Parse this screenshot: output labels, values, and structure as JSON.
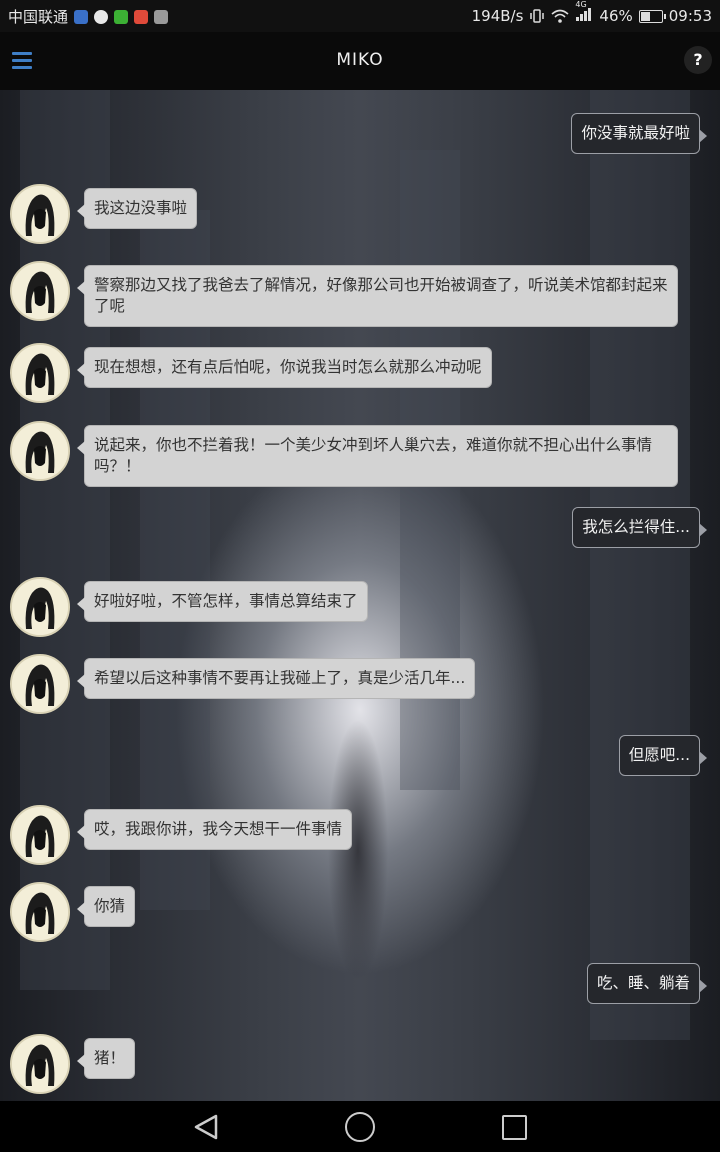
{
  "status_bar": {
    "carrier": "中国联通",
    "speed": "194B/s",
    "network_badge": "4G",
    "battery": "46%",
    "battery_level": 0.46,
    "time": "09:53",
    "icons": [
      "shield-icon",
      "qq-icon",
      "wechat-icon",
      "weibo-icon",
      "photo-icon",
      "vibrate-icon",
      "wifi-icon",
      "signal-icon",
      "battery-icon"
    ]
  },
  "app_bar": {
    "title": "MIKO",
    "help_label": "?",
    "menu_icon": "hamburger-menu-icon"
  },
  "colors": {
    "menu_blue": "#3f7fc7",
    "incoming_bubble": "#d3d3d3",
    "outgoing_bubble": "#25272c"
  },
  "messages": [
    {
      "from": "me",
      "text": "你没事就最好啦"
    },
    {
      "from": "miko",
      "text": "我这边没事啦"
    },
    {
      "from": "miko",
      "text": "警察那边又找了我爸去了解情况，好像那公司也开始被调查了，听说美术馆都封起来了呢"
    },
    {
      "from": "miko",
      "text": "现在想想，还有点后怕呢，你说我当时怎么就那么冲动呢"
    },
    {
      "from": "miko",
      "text": "说起来，你也不拦着我！一个美少女冲到坏人巢穴去，难道你就不担心出什么事情吗？！"
    },
    {
      "from": "me",
      "text": "我怎么拦得住..."
    },
    {
      "from": "miko",
      "text": "好啦好啦，不管怎样，事情总算结束了"
    },
    {
      "from": "miko",
      "text": "希望以后这种事情不要再让我碰上了，真是少活几年..."
    },
    {
      "from": "me",
      "text": "但愿吧..."
    },
    {
      "from": "miko",
      "text": "哎，我跟你讲，我今天想干一件事情"
    },
    {
      "from": "miko",
      "text": "你猜"
    },
    {
      "from": "me",
      "text": "吃、睡、躺着"
    },
    {
      "from": "miko",
      "text": "猪！"
    }
  ],
  "nav_bar": {
    "back_icon": "back-triangle-icon",
    "home_icon": "home-circle-icon",
    "recent_icon": "recent-apps-square-icon"
  }
}
